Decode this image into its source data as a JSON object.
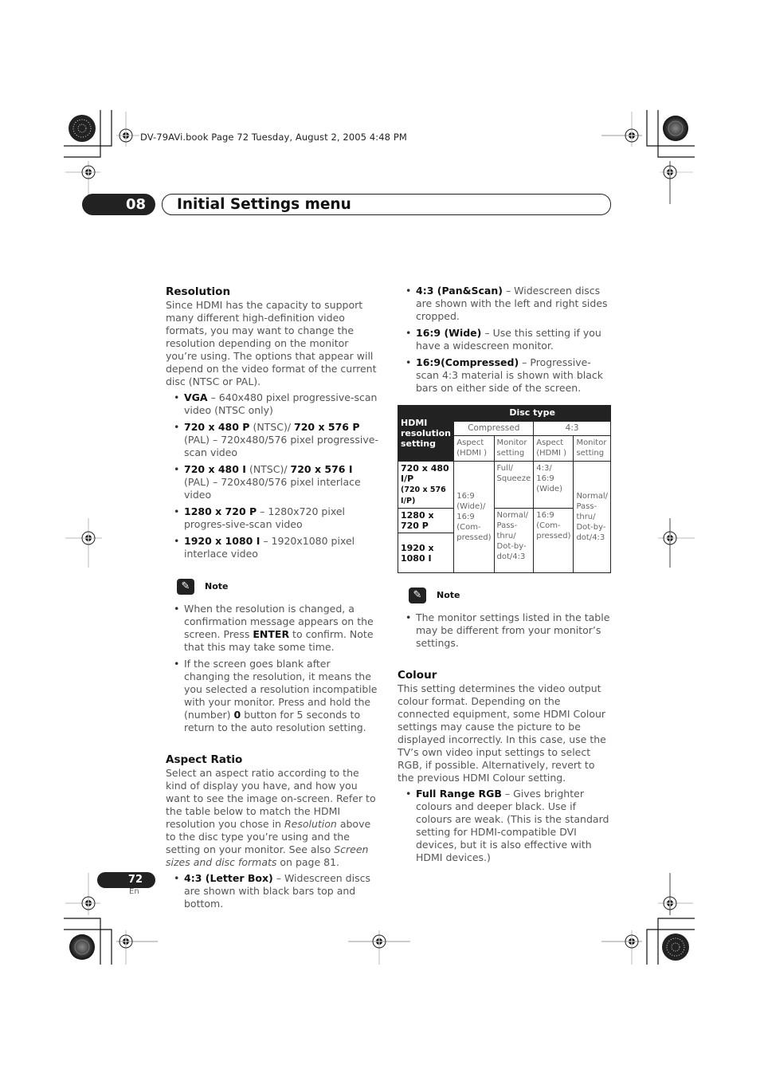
{
  "header": {
    "book_line": "DV-79AVi.book  Page 72  Tuesday, August 2, 2005  4:48 PM",
    "chapter_number": "08",
    "chapter_title": "Initial Settings menu"
  },
  "resolution": {
    "heading": "Resolution",
    "intro": "Since HDMI has the capacity to support many different high-definition video formats, you may want to change the resolution depending on the monitor you’re using. The options that appear will depend on the video format of the current disc (NTSC or PAL).",
    "options": [
      {
        "bold": "VGA",
        "text": " – 640x480 pixel progressive-scan video (NTSC only)"
      },
      {
        "bold": "720 x 480 P",
        "mid": " (NTSC)/ ",
        "bold2": "720 x 576 P",
        "text": " (PAL) – 720x480/576 pixel progressive-scan video"
      },
      {
        "bold": "720 x 480 I",
        "mid": " (NTSC)/ ",
        "bold2": "720 x 576 I",
        "text": " (PAL) – 720x480/576 pixel interlace video"
      },
      {
        "bold": "1280 x 720 P",
        "text": " – 1280x720 pixel progres-sive-scan video"
      },
      {
        "bold": "1920 x 1080 I",
        "text": " – 1920x1080 pixel interlace video"
      }
    ]
  },
  "note1": {
    "label": "Note",
    "items": [
      {
        "pre": "When the resolution is changed, a confirmation message appears on the screen. Press ",
        "bold": "ENTER",
        "post": " to confirm. Note that this may take some time."
      },
      {
        "pre": "If the screen goes blank after changing the resolution, it means the you selected a resolution incompatible with your monitor. Press and hold the (number) ",
        "bold": "0",
        "post": " button for 5 seconds to return to the auto resolution setting."
      }
    ]
  },
  "aspect_ratio": {
    "heading": "Aspect Ratio",
    "intro_pre": "Select an aspect ratio according to the kind of display you have, and how you want to see the image on-screen. Refer to the table below to match the HDMI resolution you chose in ",
    "intro_italic1": "Resolution",
    "intro_mid": " above to the disc type you’re using and the setting on your monitor. See also ",
    "intro_italic2": "Screen sizes and disc formats",
    "intro_post": " on page 81.",
    "options": [
      {
        "bold": "4:3 (Letter Box)",
        "text": " – Widescreen discs are shown with black bars top and bottom."
      },
      {
        "bold": "4:3 (Pan&Scan)",
        "text": " – Widescreen discs are shown with the left and right sides cropped."
      },
      {
        "bold": "16:9 (Wide)",
        "text": " – Use this setting if you have a widescreen monitor."
      },
      {
        "bold": "16:9(Compressed)",
        "text": " – Progressive-scan 4:3 material is shown with black bars on either side of the screen."
      }
    ]
  },
  "table": {
    "disc_type": "Disc type",
    "row_header": "HDMI resolution setting",
    "groups": [
      "Compressed",
      "4:3"
    ],
    "subheaders": [
      "Aspect (HDMI )",
      "Monitor setting",
      "Aspect (HDMI )",
      "Monitor setting"
    ],
    "rows": [
      {
        "label": "720 x 480 I/P",
        "sublabel": "(720 x 576 I/P)"
      },
      {
        "label": "1280 x 720 P"
      },
      {
        "label": "1920 x 1080 I"
      }
    ],
    "cells": {
      "compressed_aspect_all": "16:9 (Wide)/ 16:9 (Com-pressed)",
      "compressed_monitor_row1": "Full/ Squeeze",
      "compressed_monitor_rows23": "Normal/ Pass-thru/ Dot-by-dot/4:3",
      "43_aspect_row1": "4:3/ 16:9 (Wide)",
      "43_aspect_rows23": "16:9 (Com-pressed)",
      "43_monitor_all": "Normal/ Pass-thru/ Dot-by-dot/4:3"
    }
  },
  "note2": {
    "label": "Note",
    "items": [
      "The monitor settings listed in the table may be different from your monitor’s settings."
    ]
  },
  "colour": {
    "heading": "Colour",
    "intro": "This setting determines the video output colour format. Depending on the connected equipment, some HDMI Colour settings may cause the picture to be displayed incorrectly. In this case, use the TV’s own video input settings to select RGB, if possible. Alternatively, revert to the previous HDMI Colour setting.",
    "options": [
      {
        "bold": "Full Range RGB",
        "text": " – Gives brighter colours and deeper black. Use if colours are weak. (This is the standard setting for HDMI-compatible DVI devices, but it is also effective with HDMI devices.)"
      }
    ]
  },
  "footer": {
    "page_number": "72",
    "language": "En"
  }
}
